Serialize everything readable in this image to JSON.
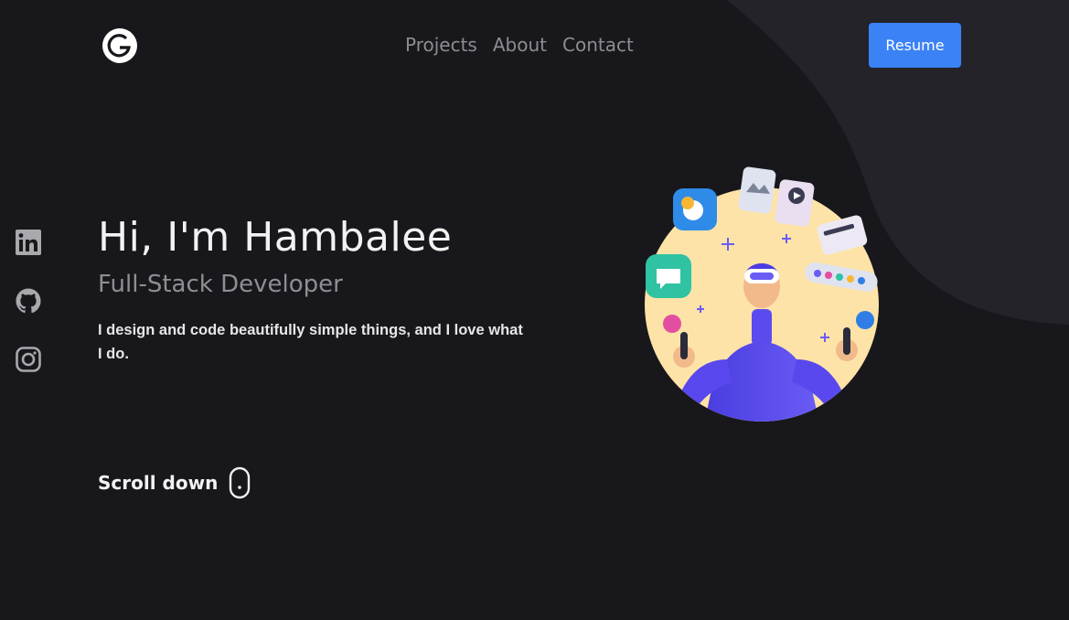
{
  "header": {
    "logo_icon": "g-logo-icon",
    "nav": [
      {
        "label": "Projects"
      },
      {
        "label": "About"
      },
      {
        "label": "Contact"
      }
    ],
    "resume_label": "Resume",
    "accent": "#3b82f6"
  },
  "social": [
    {
      "icon": "linkedin-icon"
    },
    {
      "icon": "github-icon"
    },
    {
      "icon": "instagram-icon"
    }
  ],
  "hero": {
    "title": "Hi, I'm Hambalee",
    "role": "Full-Stack Developer",
    "description": "I design and code beautifully simple things, and I love what I do.",
    "scroll_label": "Scroll down",
    "scroll_icon": "mouse-icon"
  },
  "illustration": {
    "icon": "vr-developer-illustration"
  },
  "colors": {
    "background": "#18171c",
    "blob": "#242329",
    "circle": "#fde3a7"
  }
}
